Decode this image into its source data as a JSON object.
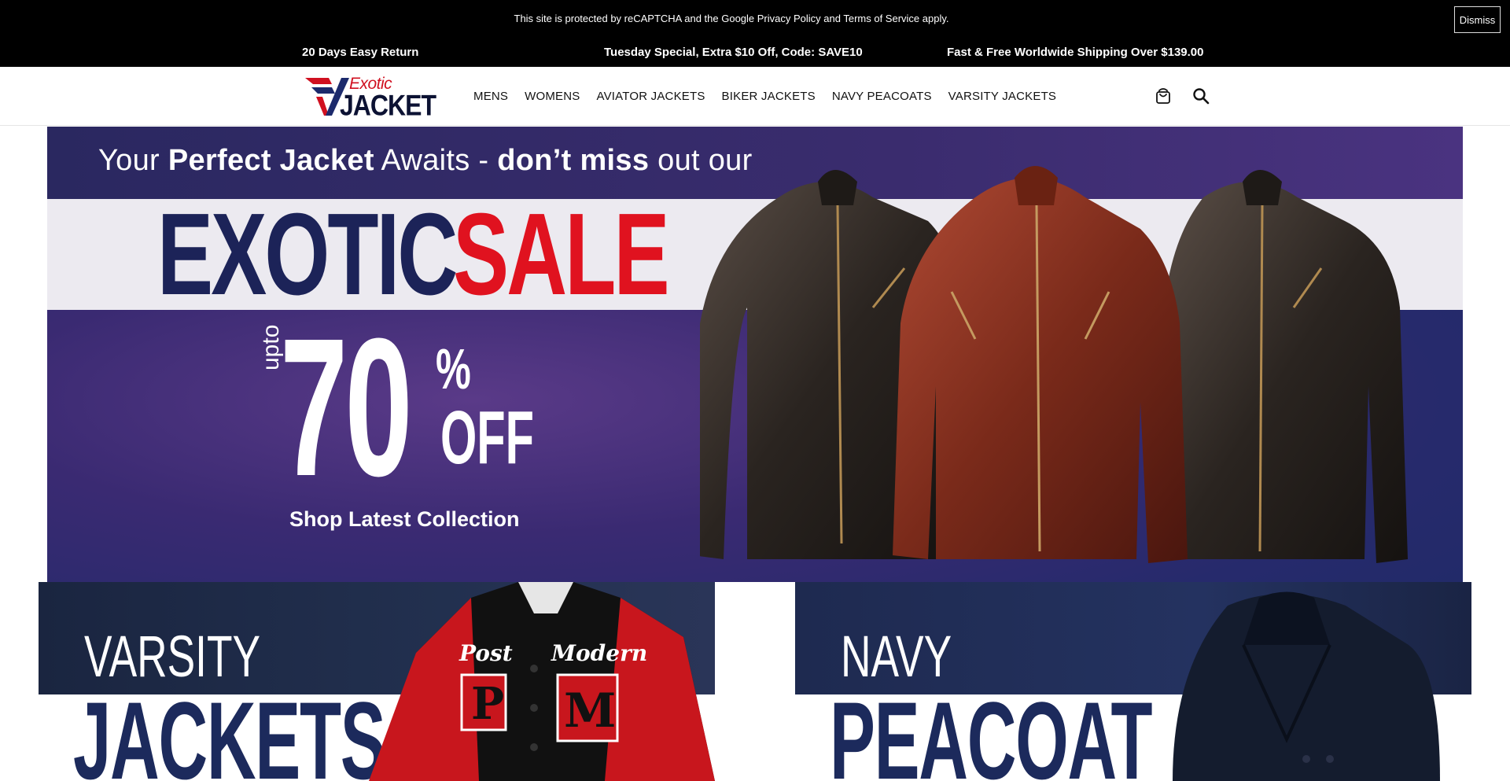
{
  "topbar": {
    "recaptcha_notice": "This site is protected by reCAPTCHA and the Google Privacy Policy and Terms of Service apply.",
    "dismiss_label": "Dismiss",
    "promos": [
      "20 Days Easy Return",
      "Tuesday Special, Extra $10 Off, Code: SAVE10",
      "Fast & Free Worldwide Shipping Over $139.00"
    ]
  },
  "header": {
    "logo": {
      "line1": "Exotic",
      "line2": "JACKET"
    },
    "nav": [
      "MENS",
      "WOMENS",
      "AVIATOR JACKETS",
      "BIKER JACKETS",
      "NAVY PEACOATS",
      "VARSITY JACKETS"
    ],
    "icons": [
      "cart-icon",
      "search-icon"
    ]
  },
  "hero": {
    "tagline_pre": "Your ",
    "tagline_bold1": "Perfect Jacket",
    "tagline_mid": " Awaits - ",
    "tagline_bold2": "don’t miss",
    "tagline_post": " out our",
    "headline_word1": "EXOTIC",
    "headline_word2": "SALE",
    "upto": "upto",
    "discount_number": "70",
    "discount_percent": "%",
    "discount_off": "OFF",
    "cta": "Shop Latest Collection"
  },
  "categories": [
    {
      "line1": "VARSITY",
      "line2": "JACKETS",
      "patch1": "Post",
      "patch2": "Modern",
      "letter1": "P",
      "letter2": "M"
    },
    {
      "line1": "NAVY",
      "line2": "PEACOAT"
    }
  ],
  "colors": {
    "brand_navy": "#1c2358",
    "brand_red": "#e0121f",
    "topbar_bg": "#000000"
  }
}
